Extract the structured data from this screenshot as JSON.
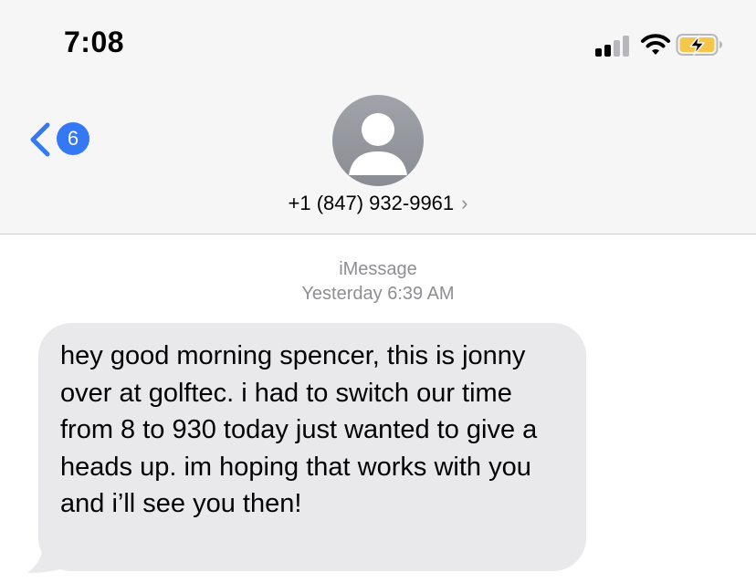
{
  "status_bar": {
    "time": "7:08"
  },
  "nav": {
    "back_badge_count": "6",
    "contact_name": "+1 (847) 932-9961",
    "contact_chevron": "›"
  },
  "conversation": {
    "service_label": "iMessage",
    "timestamp": "Yesterday 6:39 AM",
    "messages": [
      {
        "direction": "incoming",
        "text": "hey good morning spencer, this is jonny over at golftec. i had to switch our time from 8 to 930 today just wanted to give a heads up. im hoping that works with you and i’ll see you then!"
      }
    ]
  },
  "colors": {
    "accent": "#3478f6",
    "incoming_bubble": "#e9e9eb",
    "battery_charge": "#f5c64a",
    "secondary_text": "#8e8e93"
  },
  "icons": {
    "back": "chevron-left-icon",
    "avatar": "person-silhouette",
    "signal": "cellular-signal-icon",
    "wifi": "wifi-icon",
    "battery": "battery-charging-icon"
  }
}
